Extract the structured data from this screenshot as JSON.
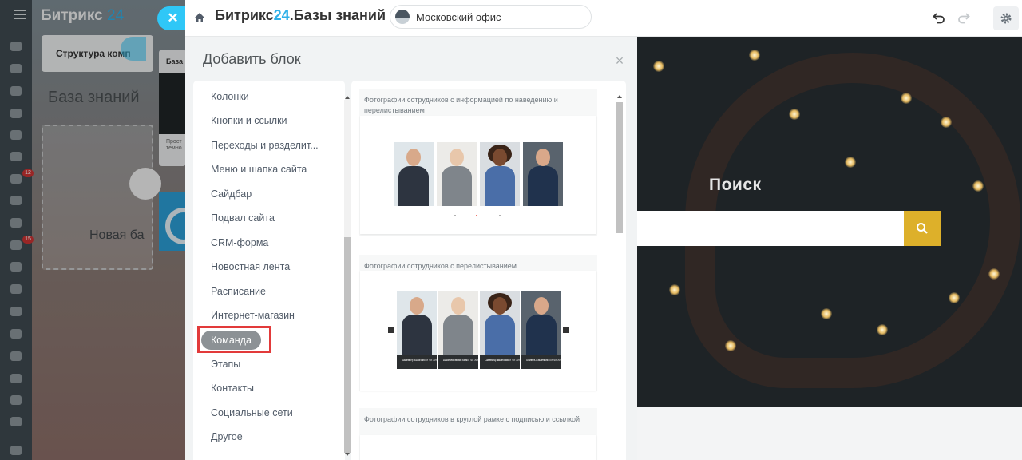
{
  "background": {
    "logo_main": "Битрикс",
    "logo_num": "24",
    "structure_label": "Структура комп",
    "kb_title": "База знаний",
    "new_base_label": "Новая ба",
    "card_header": "База",
    "card_text_1": "Прост",
    "card_text_2": "темно",
    "badges": [
      "12",
      "15"
    ]
  },
  "topbar": {
    "title_main": "Битрикс",
    "title_num": "24",
    "title_rest": ".Базы знаний",
    "site_select": "Московский офис",
    "icons": [
      "home-icon",
      "undo-icon",
      "redo-icon",
      "gear-icon"
    ]
  },
  "dialog": {
    "title": "Добавить блок",
    "close": "×",
    "categories": [
      "Колонки",
      "Кнопки и ссылки",
      "Переходы и разделит...",
      "Меню и шапка сайта",
      "Сайдбар",
      "Подвал сайта",
      "CRM-форма",
      "Новостная лента",
      "Расписание",
      "Интернет-магазин",
      "Команда",
      "Этапы",
      "Контакты",
      "Социальные сети",
      "Другое"
    ],
    "active_category": "Команда",
    "blocks": [
      {
        "caption": "Фотографии сотрудников с информацией по наведению и перелистыванием"
      },
      {
        "caption": "Фотографии сотрудников с перелистыванием"
      },
      {
        "caption": "Фотографии сотрудников в круглой рамке с подписью и ссылкой"
      }
    ],
    "team_strip": [
      {
        "name": "TARIFF CLOSE",
        "role": "Lorem ipsum dolor sit amet"
      },
      {
        "name": "JACOB MINTON",
        "role": "Lorem ipsum dolor sit amet"
      },
      {
        "name": "CAROL MORRIS",
        "role": "Lorem ipsum dolor sit amet"
      },
      {
        "name": "TOM COOPER",
        "role": "Lorem ipsum dolor sit amet"
      }
    ]
  },
  "preview": {
    "search_title": "Поиск",
    "search_placeholder": ""
  },
  "colors": {
    "accent": "#2fc7f7",
    "search_button": "#ddb02a",
    "active_category": "#8c9195",
    "highlight": "#e23a3a"
  }
}
